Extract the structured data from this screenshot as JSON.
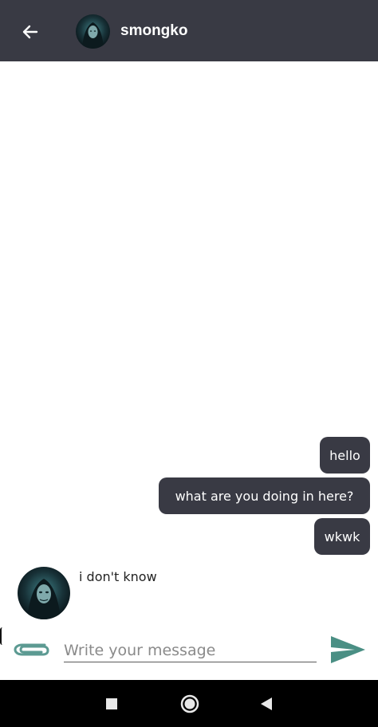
{
  "header": {
    "contact_name": "smongko",
    "back_icon": "arrow-left-icon",
    "avatar_icon": "hooded-figure-avatar"
  },
  "messages": [
    {
      "direction": "outgoing",
      "text": "hello"
    },
    {
      "direction": "outgoing",
      "text": "what are you doing in here?"
    },
    {
      "direction": "outgoing",
      "text": "wkwk"
    },
    {
      "direction": "incoming",
      "text": "i don't know"
    }
  ],
  "composer": {
    "placeholder": "Write your message",
    "value": "",
    "attach_icon": "paperclip-icon",
    "send_icon": "send-icon"
  },
  "navbar": {
    "recents_icon": "square-icon",
    "home_icon": "circle-icon",
    "back_icon": "triangle-back-icon"
  },
  "colors": {
    "appbar": "#393a44",
    "bubble": "#393a44",
    "accent_teal": "#4a8f84",
    "navbar": "#000000"
  }
}
